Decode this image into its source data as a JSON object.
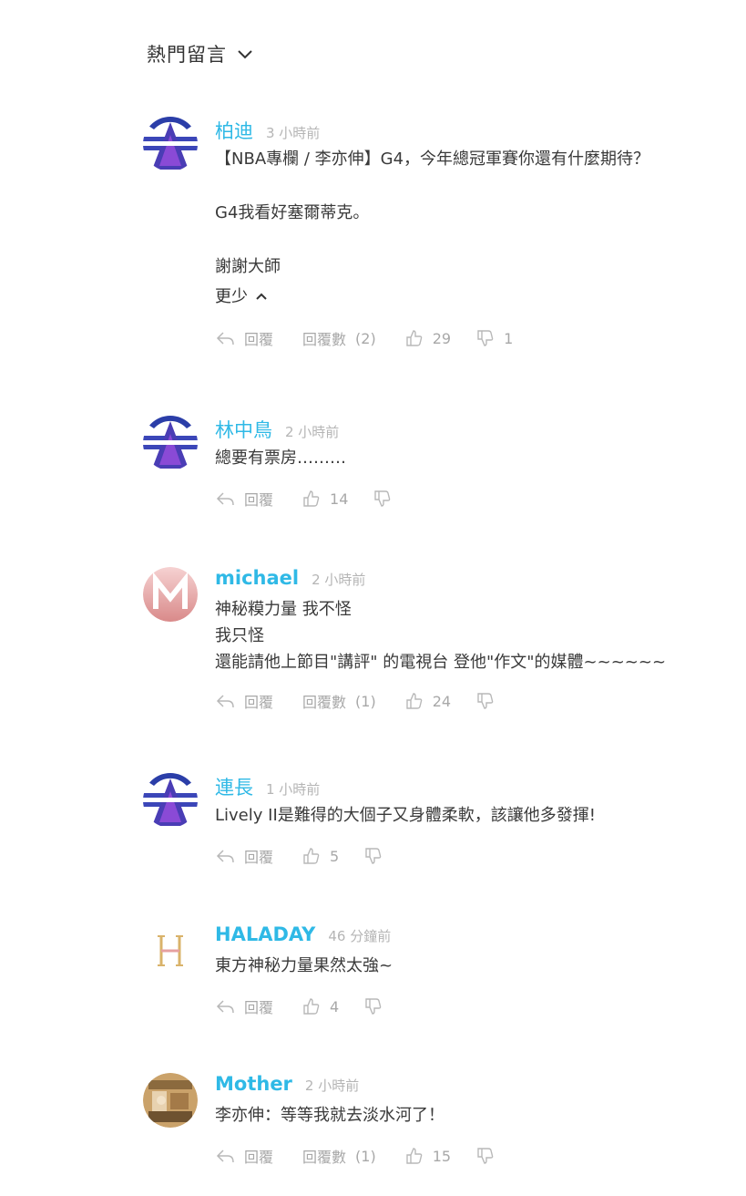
{
  "header": {
    "sort_label": "熱門留言"
  },
  "actions": {
    "reply_label": "回覆",
    "replies_label": "回覆數"
  },
  "comments": [
    {
      "username": "柏迪",
      "time": "3 小時前",
      "lines": [
        "【NBA專欄 / 李亦伸】G4，今年總冠軍賽你還有什麼期待？",
        "",
        "G4我看好塞爾蒂克。",
        "",
        " 謝謝大師"
      ],
      "less_label": "更少",
      "replies_count": "(2)",
      "likes": "29",
      "dislikes": "1",
      "avatar": "A"
    },
    {
      "username": "林中鳥",
      "time": "2 小時前",
      "lines": [
        "總要有票房………"
      ],
      "likes": "14",
      "dislikes": "",
      "avatar": "A"
    },
    {
      "username": "michael",
      "time": "2 小時前",
      "lines": [
        "神秘糢力量 我不怪",
        "我只怪",
        "還能請他上節目\"講評\" 的電視台 登他\"作文\"的媒體~~~~~~"
      ],
      "replies_count": "(1)",
      "likes": "24",
      "dislikes": "",
      "avatar": "M"
    },
    {
      "username": "連長",
      "time": "1 小時前",
      "lines": [
        "Lively II是難得的大個子又身體柔軟，該讓他多發揮!"
      ],
      "likes": "5",
      "dislikes": "",
      "avatar": "A"
    },
    {
      "username": "HALADAY",
      "time": "46 分鐘前",
      "lines": [
        "東方神秘力量果然太強~"
      ],
      "likes": "4",
      "dislikes": "",
      "avatar": "H"
    },
    {
      "username": "Mother",
      "time": "2 小時前",
      "lines": [
        "李亦伸：等等我就去淡水河了！"
      ],
      "replies_count": "(1)",
      "likes": "15",
      "dislikes": "",
      "avatar": "photo"
    }
  ],
  "colors": {
    "username": "#2fb9e6",
    "timestamp": "#b5b5b5",
    "action": "#a8a8a8",
    "text": "#3a3a3a",
    "avatar_a_top": "#2b3ea8",
    "avatar_a_bottom": "#7a3fc8"
  },
  "icons": [
    "chevron-down-icon",
    "chevron-up-icon",
    "reply-icon",
    "thumbs-up-icon",
    "thumbs-down-icon"
  ]
}
